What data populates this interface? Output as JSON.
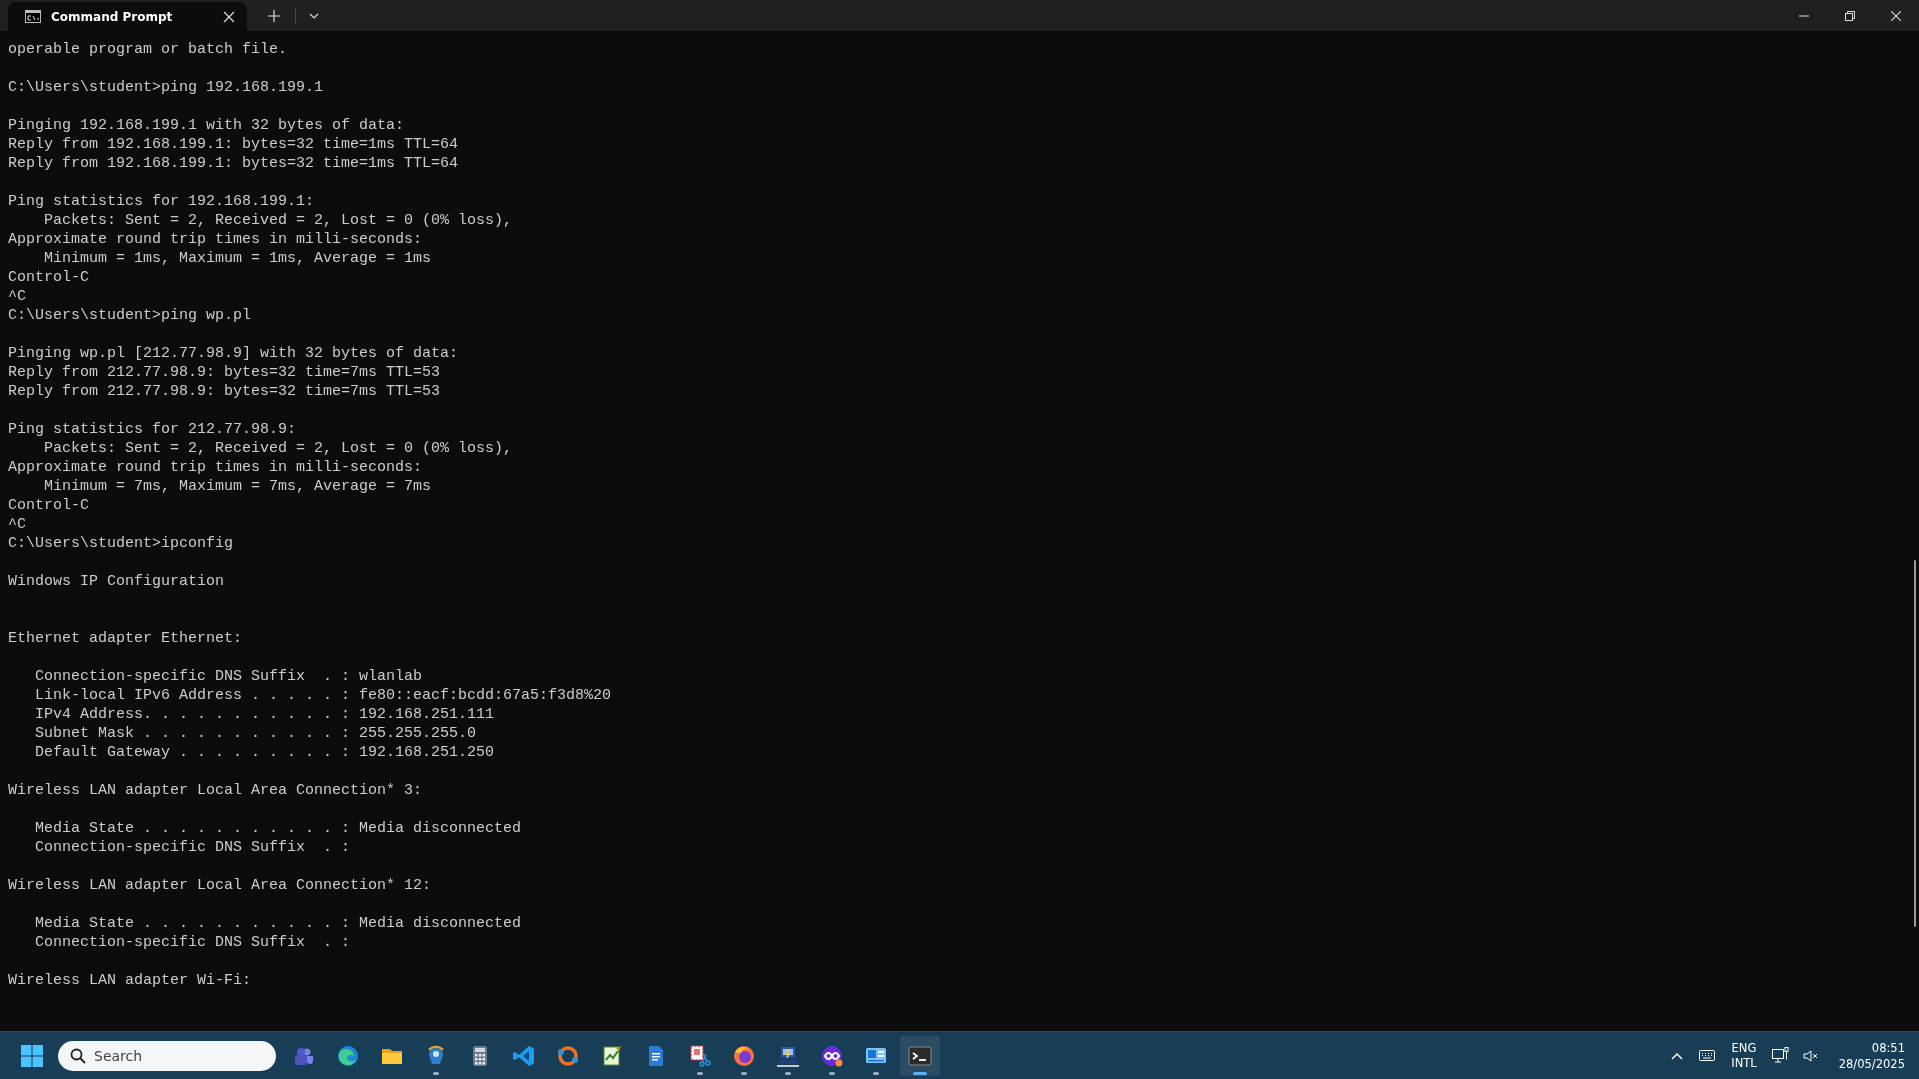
{
  "window": {
    "tabs": [
      {
        "title": "Command Prompt",
        "selected": true
      }
    ]
  },
  "terminal": {
    "lines": [
      {
        "kind": "text",
        "text": "operable program or batch file."
      },
      {
        "kind": "blank"
      },
      {
        "kind": "text",
        "text": "C:\\Users\\student>ping 192.168.199.1"
      },
      {
        "kind": "blank"
      },
      {
        "kind": "text",
        "text": "Pinging 192.168.199.1 with 32 bytes of data:"
      },
      {
        "kind": "text",
        "text": "Reply from 192.168.199.1: bytes=32 time=1ms TTL=64"
      },
      {
        "kind": "text",
        "text": "Reply from 192.168.199.1: bytes=32 time=1ms TTL=64"
      },
      {
        "kind": "blank"
      },
      {
        "kind": "text",
        "text": "Ping statistics for 192.168.199.1:"
      },
      {
        "kind": "text",
        "text": "    Packets: Sent = 2, Received = 2, Lost = 0 (0% loss),"
      },
      {
        "kind": "text",
        "text": "Approximate round trip times in milli-seconds:"
      },
      {
        "kind": "text",
        "text": "    Minimum = 1ms, Maximum = 1ms, Average = 1ms"
      },
      {
        "kind": "text",
        "text": "Control-C"
      },
      {
        "kind": "text",
        "text": "^C"
      },
      {
        "kind": "text",
        "text": "C:\\Users\\student>ping wp.pl"
      },
      {
        "kind": "blank"
      },
      {
        "kind": "text",
        "text": "Pinging wp.pl [212.77.98.9] with 32 bytes of data:"
      },
      {
        "kind": "text",
        "text": "Reply from 212.77.98.9: bytes=32 time=7ms TTL=53"
      },
      {
        "kind": "text",
        "text": "Reply from 212.77.98.9: bytes=32 time=7ms TTL=53"
      },
      {
        "kind": "blank"
      },
      {
        "kind": "text",
        "text": "Ping statistics for 212.77.98.9:"
      },
      {
        "kind": "text",
        "text": "    Packets: Sent = 2, Received = 2, Lost = 0 (0% loss),"
      },
      {
        "kind": "text",
        "text": "Approximate round trip times in milli-seconds:"
      },
      {
        "kind": "text",
        "text": "    Minimum = 7ms, Maximum = 7ms, Average = 7ms"
      },
      {
        "kind": "text",
        "text": "Control-C"
      },
      {
        "kind": "text",
        "text": "^C"
      },
      {
        "kind": "text",
        "text": "C:\\Users\\student>ipconfig"
      },
      {
        "kind": "blank"
      },
      {
        "kind": "text",
        "text": "Windows IP Configuration"
      },
      {
        "kind": "blank"
      },
      {
        "kind": "blank"
      },
      {
        "kind": "text",
        "text": "Ethernet adapter Ethernet:"
      },
      {
        "kind": "blank"
      },
      {
        "kind": "text",
        "text": "   Connection-specific DNS Suffix  . : wlanlab"
      },
      {
        "kind": "text",
        "text": "   Link-local IPv6 Address . . . . . : fe80::eacf:bcdd:67a5:f3d8%20"
      },
      {
        "kind": "text",
        "text": "   IPv4 Address. . . . . . . . . . . : 192.168.251.111"
      },
      {
        "kind": "text",
        "text": "   Subnet Mask . . . . . . . . . . . : 255.255.255.0"
      },
      {
        "kind": "text",
        "text": "   Default Gateway . . . . . . . . . : 192.168.251.250"
      },
      {
        "kind": "blank"
      },
      {
        "kind": "text",
        "text": "Wireless LAN adapter Local Area Connection* 3:"
      },
      {
        "kind": "blank"
      },
      {
        "kind": "text",
        "text": "   Media State . . . . . . . . . . . : Media disconnected"
      },
      {
        "kind": "text",
        "text": "   Connection-specific DNS Suffix  . :"
      },
      {
        "kind": "blank"
      },
      {
        "kind": "text",
        "text": "Wireless LAN adapter Local Area Connection* 12:"
      },
      {
        "kind": "blank"
      },
      {
        "kind": "text",
        "text": "   Media State . . . . . . . . . . . : Media disconnected"
      },
      {
        "kind": "text",
        "text": "   Connection-specific DNS Suffix  . :"
      },
      {
        "kind": "blank"
      },
      {
        "kind": "text",
        "text": "Wireless LAN adapter Wi-Fi:"
      }
    ]
  },
  "taskbar": {
    "search": {
      "placeholder": "Search"
    },
    "apps": [
      {
        "kind": "people",
        "running": false,
        "selected": false
      },
      {
        "kind": "wave",
        "running": false,
        "selected": false
      },
      {
        "kind": "folder",
        "running": false,
        "selected": false
      },
      {
        "kind": "antenna",
        "running": true,
        "selected": false
      },
      {
        "kind": "calculator",
        "running": false,
        "selected": false
      },
      {
        "kind": "code",
        "running": false,
        "selected": false
      },
      {
        "kind": "ring",
        "running": false,
        "selected": false
      },
      {
        "kind": "notepad",
        "running": false,
        "selected": false
      },
      {
        "kind": "document",
        "running": false,
        "selected": false
      },
      {
        "kind": "scissors",
        "running": true,
        "selected": false
      },
      {
        "kind": "fox",
        "running": true,
        "selected": false
      },
      {
        "kind": "cable",
        "running": true,
        "selected": false
      },
      {
        "kind": "mask",
        "running": true,
        "selected": false
      },
      {
        "kind": "remote",
        "running": true,
        "selected": false
      },
      {
        "kind": "terminal",
        "running": true,
        "selected": true
      }
    ],
    "tray": {
      "language": "ENG",
      "layout": "INTL",
      "time": "08:51",
      "date": "28/05/2025"
    }
  }
}
